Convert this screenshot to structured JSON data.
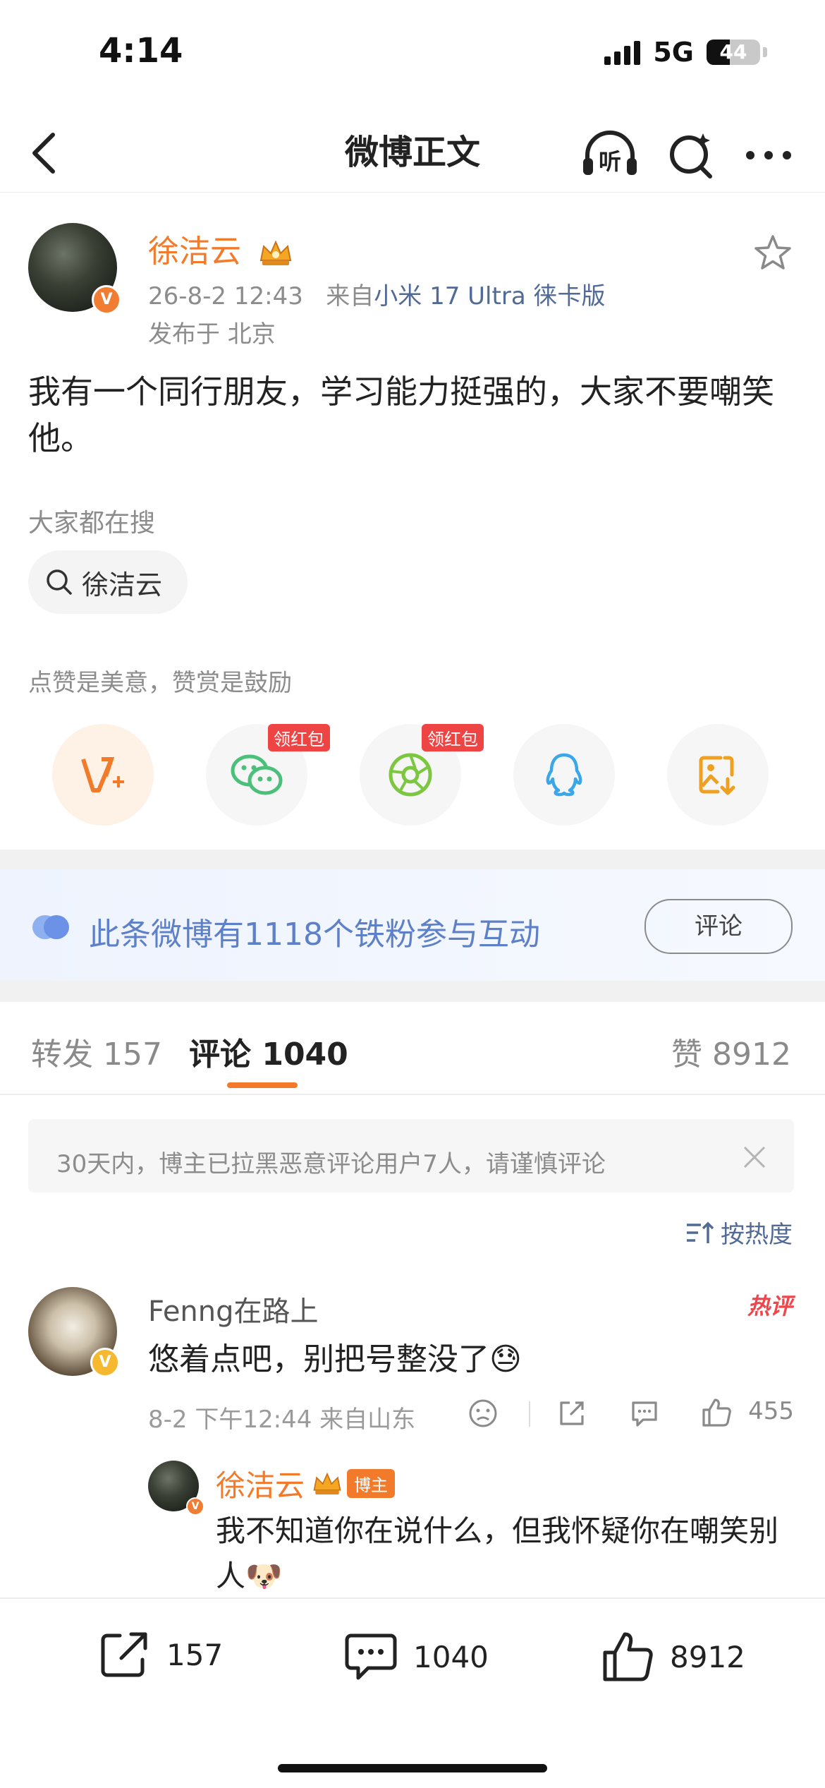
{
  "status_bar": {
    "time": "4:14",
    "network": "5G",
    "battery": "44"
  },
  "nav": {
    "title": "微博正文"
  },
  "post": {
    "author": "徐洁云",
    "time": "26-8-2 12:43",
    "from_prefix": "来自",
    "device": "小米 17 Ultra 徕卡版",
    "location": "发布于 北京",
    "text": "我有一个同行朋友，学习能力挺强的，大家不要嘲笑他。",
    "search_hint": "大家都在搜",
    "search_term": "徐洁云",
    "reward_hint": "点赞是美意，赞赏是鼓励",
    "share_items": [
      {
        "icon": "reward-icon"
      },
      {
        "icon": "wechat-icon",
        "tag": "领红包"
      },
      {
        "icon": "moments-icon",
        "tag": "领红包"
      },
      {
        "icon": "qq-icon"
      },
      {
        "icon": "save-image-icon"
      }
    ]
  },
  "fans_bar": {
    "text": "此条微博有1118个铁粉参与互动",
    "button": "评论"
  },
  "tabs": {
    "repost_label": "转发",
    "repost_count": "157",
    "comment_label": "评论",
    "comment_count": "1040",
    "like_label": "赞",
    "like_count": "8912"
  },
  "notice": {
    "text": "30天内，博主已拉黑恶意评论用户7人，请谨慎评论"
  },
  "sort": {
    "label": "按热度"
  },
  "comment": {
    "user": "Fenng在路上",
    "hot_label": "热评",
    "text": "悠着点吧，别把号整没了😓",
    "meta": "8-2 下午12:44 来自山东",
    "likes": "455",
    "reply": {
      "user": "徐洁云",
      "badge": "博主",
      "text": "我不知道你在说什么，但我怀疑你在嘲笑别人🐶"
    }
  },
  "bottom_bar": {
    "repost": "157",
    "comment": "1040",
    "like": "8912"
  },
  "colors": {
    "accent": "#f27b2b",
    "link": "#526a96",
    "fans": "#5d80c8",
    "hot": "#f0454a"
  }
}
